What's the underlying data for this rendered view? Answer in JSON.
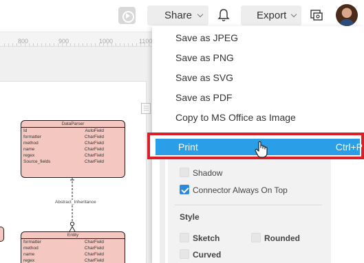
{
  "toolbar": {
    "share_label": "Share",
    "export_label": "Export"
  },
  "ruler": {
    "ticks": [
      "800",
      "900",
      "1000",
      "1100"
    ]
  },
  "diagram": {
    "dataparser": {
      "title": "DataParser",
      "fields": [
        {
          "name": "Id",
          "type": "AutoField"
        },
        {
          "name": "formatter",
          "type": "CharField"
        },
        {
          "name": "method",
          "type": "CharField"
        },
        {
          "name": "name",
          "type": "CharField"
        },
        {
          "name": "regex",
          "type": "CharField"
        },
        {
          "name": "Source_fields",
          "type": "CharField"
        }
      ]
    },
    "connector_label": "Abstract_Inheritance",
    "entity": {
      "title": "Entity",
      "fields": [
        {
          "name": "formatter",
          "type": "CharField"
        },
        {
          "name": "method",
          "type": "CharField"
        },
        {
          "name": "name",
          "type": "CharField"
        },
        {
          "name": "regex",
          "type": "CharField"
        }
      ]
    }
  },
  "export_menu": {
    "items": [
      "Save as JPEG",
      "Save as PNG",
      "Save as SVG",
      "Save as PDF",
      "Copy to MS Office as Image"
    ],
    "print": {
      "label": "Print",
      "shortcut": "Ctrl+P"
    }
  },
  "options_panel": {
    "shadow_label": "Shadow",
    "shadow_checked": false,
    "connector_on_top_label": "Connector Always On Top",
    "connector_on_top_checked": true,
    "style_title": "Style",
    "sketch_label": "Sketch",
    "rounded_label": "Rounded",
    "curved_label": "Curved"
  }
}
